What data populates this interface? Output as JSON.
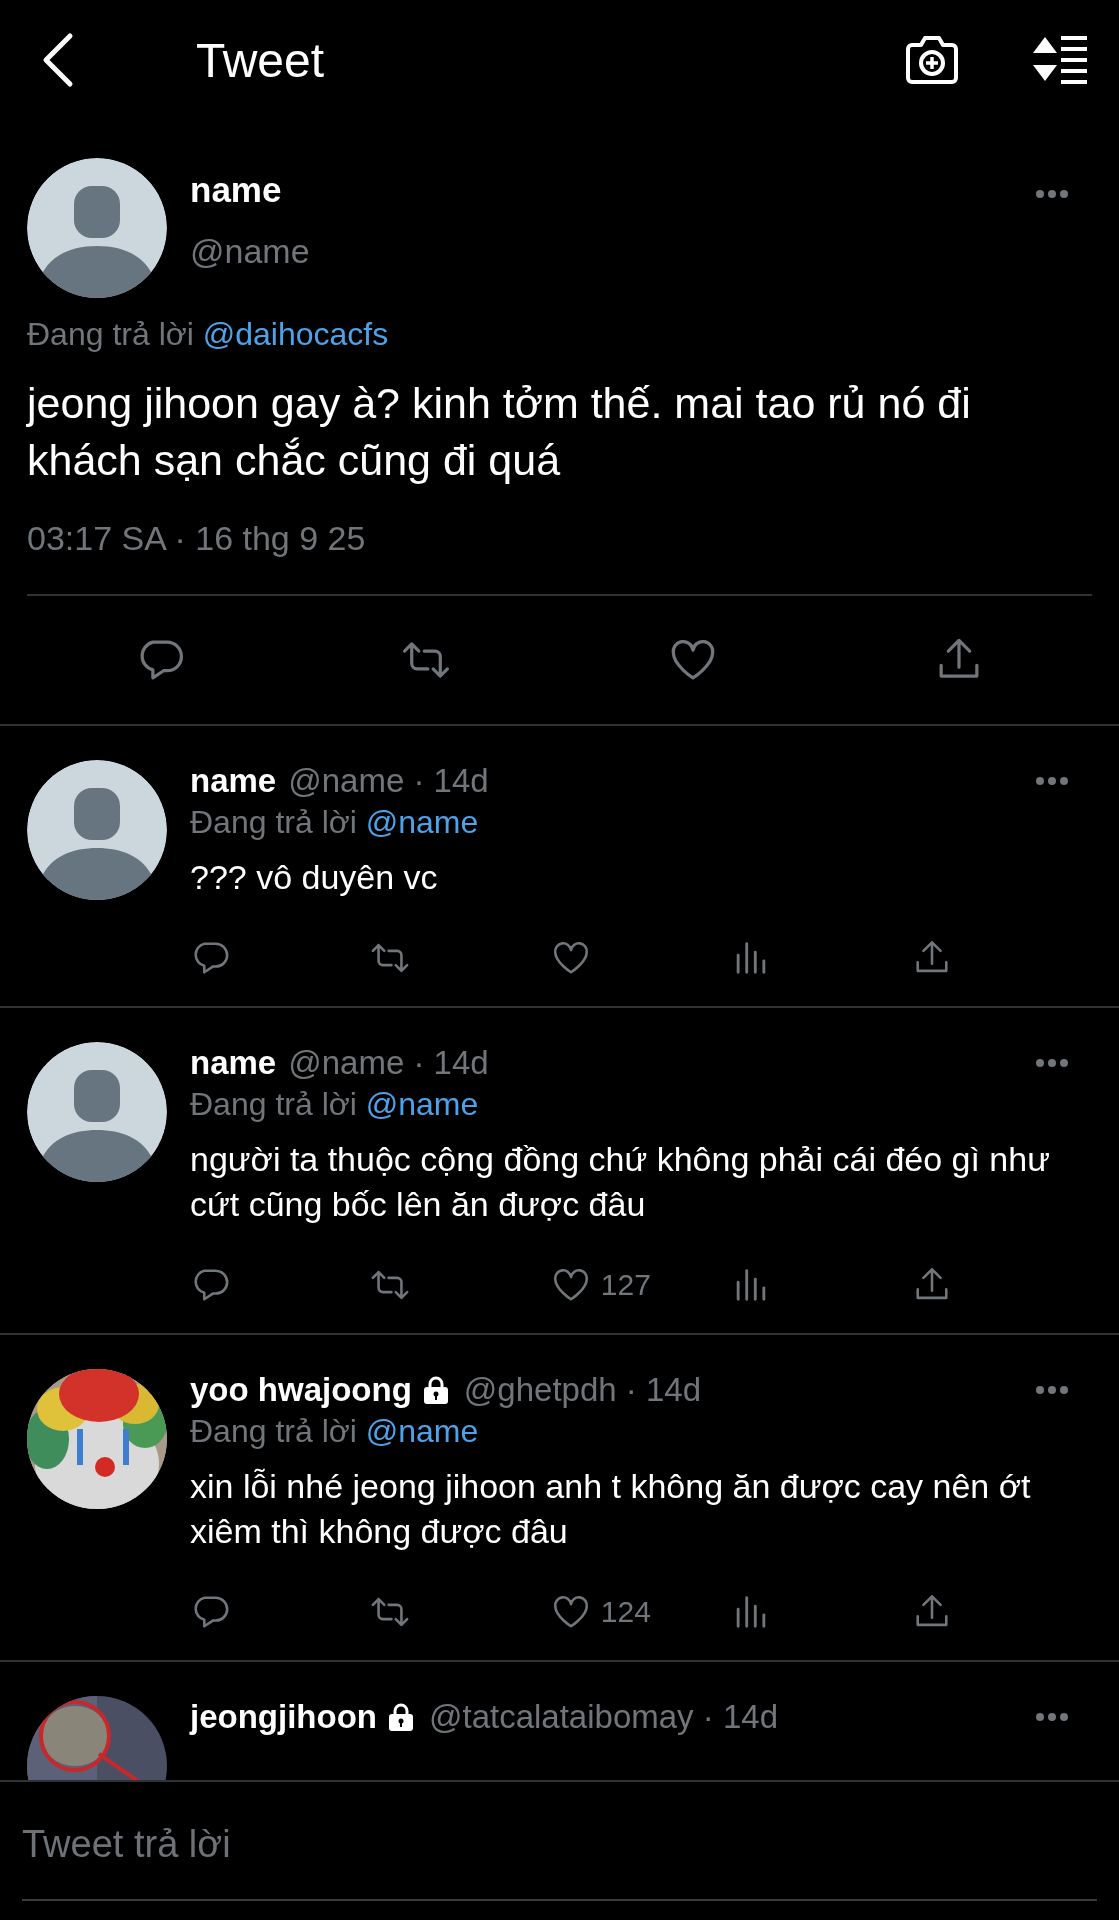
{
  "header": {
    "title": "Tweet"
  },
  "main_tweet": {
    "name": "name",
    "handle": "@name",
    "replying_label": "Đang trả lời",
    "replying_to": "@daihocacfs",
    "text": "jeong jihoon gay à? kinh tởm thế. mai tao rủ nó đi khách sạn chắc cũng đi quá",
    "timestamp": "03:17 SA · 16 thg 9 25"
  },
  "replies": [
    {
      "avatar": {
        "kind": "default"
      },
      "name": "name",
      "locked": false,
      "meta": "@name · 14d",
      "replying_label": "Đang trả lời",
      "replying_to": "@name",
      "text": "??? vô duyên vc"
    },
    {
      "avatar": {
        "kind": "default"
      },
      "name": "name",
      "locked": false,
      "meta": "@name · 14d",
      "replying_label": "Đang trả lời",
      "replying_to": "@name",
      "text": "người ta thuộc cộng đồng chứ không phải cái đéo gì như cứt cũng bốc lên ăn được đâu",
      "likes": "127"
    },
    {
      "avatar": {
        "kind": "clown"
      },
      "name": "yoo hwajoong",
      "locked": true,
      "meta": "@ghetpdh · 14d",
      "replying_label": "Đang trả lời",
      "replying_to": "@name",
      "text": "xin lỗi nhé jeong jihoon anh t không ăn được cay nên ớt xiêm thì không được đâu",
      "likes": "124"
    },
    {
      "name": "jeongjihoon",
      "locked": true,
      "meta": "@tatcalataibomay · 14d"
    }
  ],
  "composer": {
    "placeholder": "Tweet trả lời"
  }
}
